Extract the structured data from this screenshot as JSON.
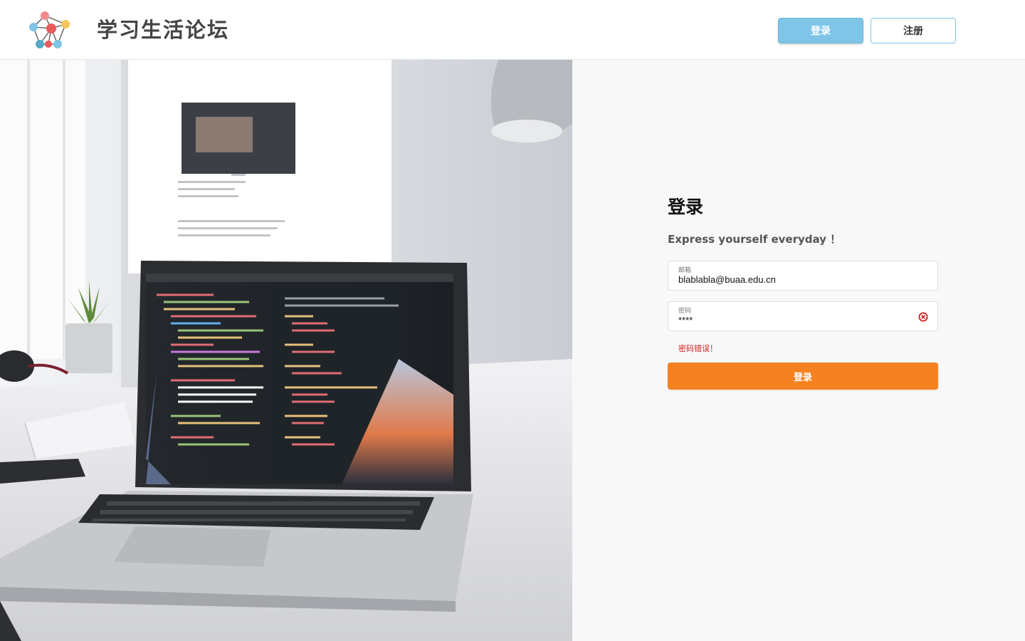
{
  "header": {
    "site_title": "学习生活论坛",
    "login_label": "登录",
    "register_label": "注册",
    "colors": {
      "login_button": "#7ec5e8",
      "register_border": "#7ec5e8"
    }
  },
  "form": {
    "title": "登录",
    "subtitle": "Express yourself everyday ！",
    "email": {
      "label": "邮箱",
      "value": "blablabla@buaa.edu.cn"
    },
    "password": {
      "label": "密码",
      "value": "****",
      "icon": "error-circle-icon"
    },
    "error_message": "密码错误！",
    "submit_label": "登录",
    "colors": {
      "submit": "#f58220",
      "error": "#d81e1e"
    }
  },
  "hero": {
    "icon": "laptop-desk-photo"
  }
}
